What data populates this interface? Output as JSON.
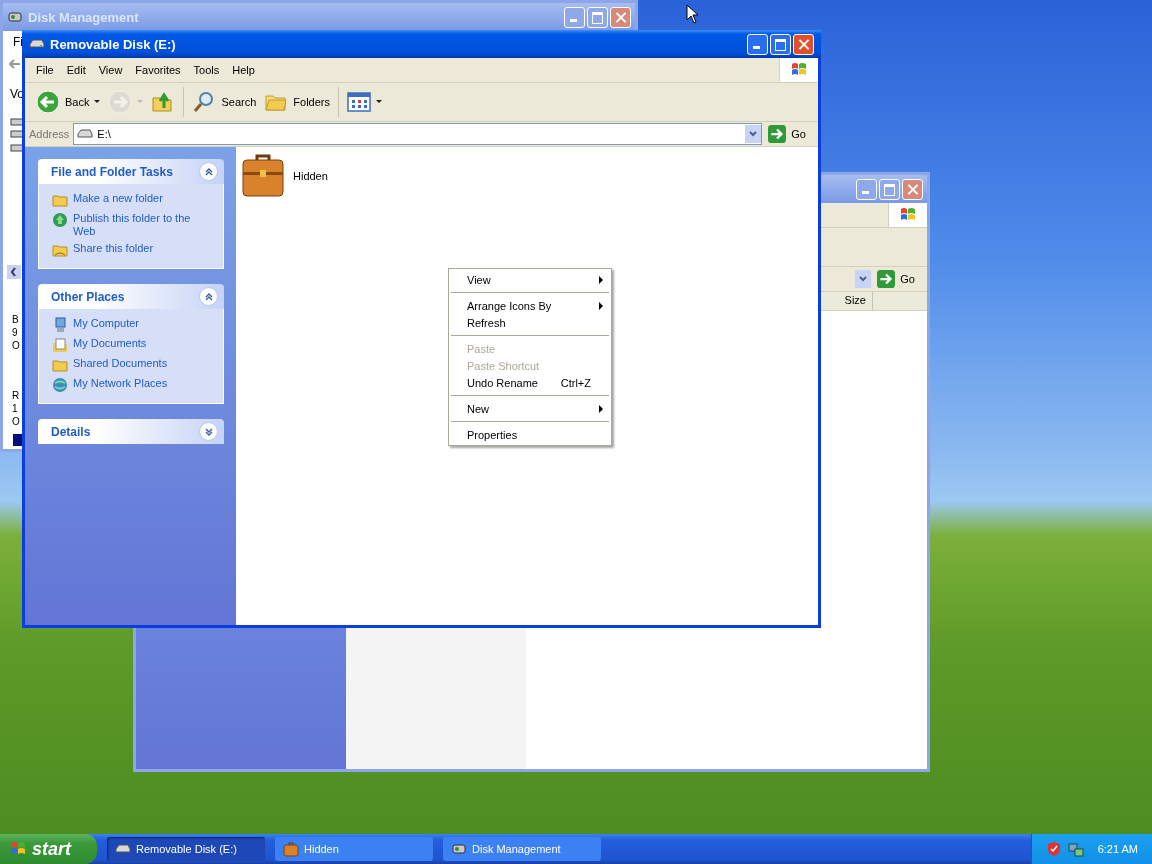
{
  "disk_management": {
    "title": "Disk Management",
    "menu_fragment": "Fi",
    "column_fragment": "Vo",
    "volumes": [
      {
        "lines": [
          "B",
          "9",
          "O"
        ]
      },
      {
        "lines": [
          "R",
          "1",
          "O"
        ]
      }
    ]
  },
  "hidden_window": {
    "go": "Go",
    "columns": [
      "Size"
    ]
  },
  "window": {
    "title": "Removable Disk (E:)",
    "menu": [
      "File",
      "Edit",
      "View",
      "Favorites",
      "Tools",
      "Help"
    ],
    "toolbar": [
      {
        "kind": "back",
        "label": "Back",
        "disabled": false
      },
      {
        "kind": "forward",
        "disabled": true
      },
      {
        "kind": "up",
        "disabled": false
      },
      {
        "kind": "search",
        "label": "Search",
        "disabled": false
      },
      {
        "kind": "folders",
        "label": "Folders",
        "disabled": false
      },
      {
        "kind": "views",
        "disabled": false
      }
    ],
    "address": {
      "label": "Address",
      "value": "E:\\",
      "go": "Go"
    },
    "panels": [
      {
        "title": "File and Folder Tasks",
        "expanded": true,
        "items": [
          {
            "kind": "new-folder",
            "label": "Make a new folder"
          },
          {
            "kind": "globe",
            "label": "Publish this folder to the Web"
          },
          {
            "kind": "share",
            "label": "Share this folder"
          }
        ]
      },
      {
        "title": "Other Places",
        "expanded": true,
        "items": [
          {
            "kind": "computer",
            "label": "My Computer"
          },
          {
            "kind": "documents",
            "label": "My Documents"
          },
          {
            "kind": "folder",
            "label": "Shared Documents"
          },
          {
            "kind": "network",
            "label": "My Network Places"
          }
        ]
      },
      {
        "title": "Details",
        "expanded": false
      }
    ],
    "files": [
      {
        "name": "Hidden"
      }
    ]
  },
  "context_menu": [
    {
      "kind": "item",
      "label": "View",
      "submenu": true,
      "disabled": false
    },
    {
      "kind": "separator"
    },
    {
      "kind": "item",
      "label": "Arrange Icons By",
      "submenu": true,
      "disabled": false
    },
    {
      "kind": "item",
      "label": "Refresh",
      "submenu": false,
      "disabled": false
    },
    {
      "kind": "separator"
    },
    {
      "kind": "item",
      "label": "Paste",
      "submenu": false,
      "disabled": true
    },
    {
      "kind": "item",
      "label": "Paste Shortcut",
      "submenu": false,
      "disabled": true
    },
    {
      "kind": "item",
      "label": "Undo Rename",
      "shortcut": "Ctrl+Z",
      "submenu": false,
      "disabled": false
    },
    {
      "kind": "separator"
    },
    {
      "kind": "item",
      "label": "New",
      "submenu": true,
      "disabled": false
    },
    {
      "kind": "separator"
    },
    {
      "kind": "item",
      "label": "Properties",
      "submenu": false,
      "disabled": false
    }
  ],
  "taskbar": {
    "start": "start",
    "buttons": [
      {
        "kind": "drive",
        "label": "Removable Disk (E:)",
        "selected": true
      },
      {
        "kind": "briefcase",
        "label": "Hidden",
        "selected": false
      },
      {
        "kind": "disk-tool",
        "label": "Disk Management",
        "selected": false
      }
    ],
    "clock": "6:21 AM"
  }
}
